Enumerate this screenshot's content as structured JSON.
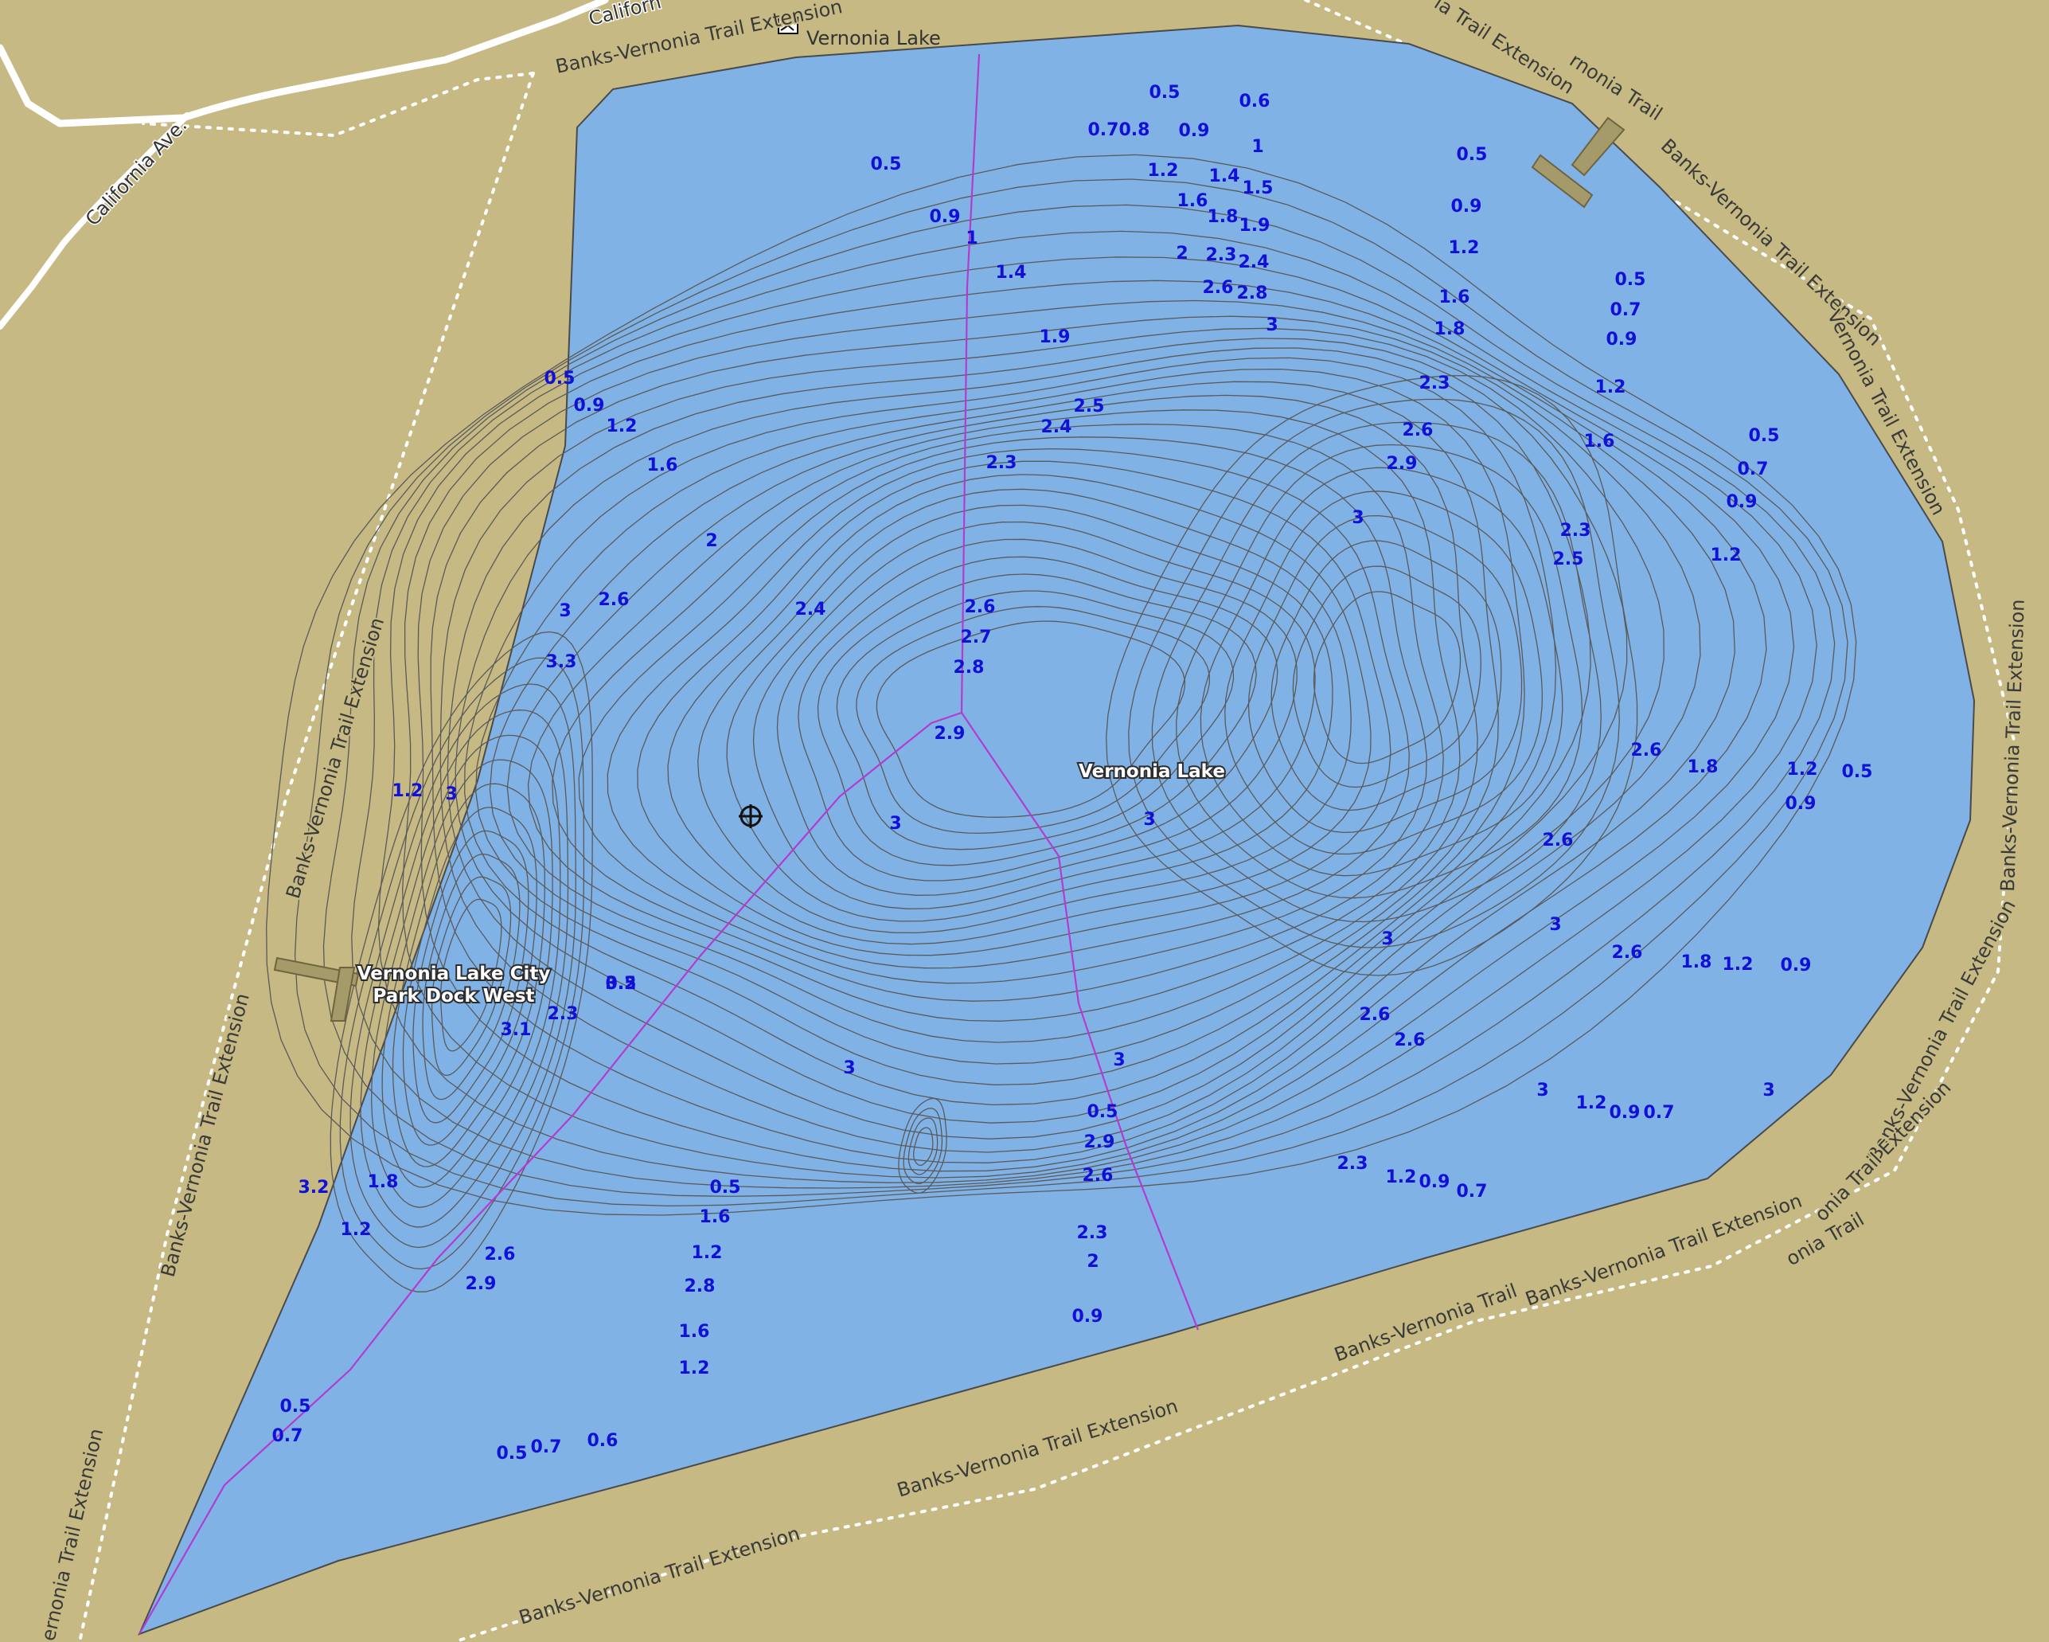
{
  "map": {
    "colors": {
      "land": "#c6b983",
      "water": "#80b2e6",
      "contour": "#5a5a5a",
      "depth_label": "#1010d8",
      "survey_line": "#b23cd0",
      "road": "#ffffff",
      "dock": "#a59a6a"
    },
    "icons": [
      "marina-icon",
      "crosshair-icon"
    ],
    "lake_name": "Vernonia Lake",
    "lake_name_top": "Vernonia Lake",
    "dock_name_line1": "Vernonia Lake City",
    "dock_name_line2": "Park Dock West",
    "road_name_diag": "California Ave.",
    "road_name_top": "Californ",
    "trails": {
      "t_top": "Banks-Vernonia Trail Extension",
      "t_topright": "ia Trail Extension",
      "t_topright2": "rnonia Trail",
      "t_right_diag1": "Banks-Vernonia Trail Extension",
      "t_right_diag2": "Vernonia Trail Extension",
      "t_right_vert": "Banks-Vernonia Trail Extension",
      "t_right_lower": "Banks-Vernonia Trail Extension",
      "t_right_lower2": "onia Trail Extension",
      "t_right_bottom": "onia Trail",
      "t_bottom_right1": "Banks-Vernonia Trail",
      "t_bottom_right2": "Banks-Vernonia Trail Extension",
      "t_bottom_mid": "Banks-Vernonia Trail Extension",
      "t_bottom_left": "Banks-Vernonia Trail Extension",
      "t_left_upper": "Banks-Vernonia Trail Extension",
      "t_left_lower": "Banks-Vernonia Trail Extension",
      "t_left_bottom": "ernonia Trail Extension"
    },
    "depth_labels": [
      "0.5",
      "0.6",
      "0.7",
      "0.8",
      "0.9",
      "1",
      "0.5",
      "0.9",
      "1",
      "1.2",
      "1.4",
      "1.5",
      "1.6",
      "1.8",
      "1.9",
      "1.4",
      "2",
      "2.3",
      "2.4",
      "2.6",
      "2.8",
      "1.9",
      "3",
      "0.5",
      "0.9",
      "1.2",
      "1.6",
      "1.8",
      "0.5",
      "0.7",
      "0.9",
      "1.2",
      "2.3",
      "2.5",
      "2.4",
      "2.3",
      "2.6",
      "2.9",
      "1.6",
      "0.5",
      "0.7",
      "0.9",
      "0.5",
      "0.9",
      "1.2",
      "1.6",
      "2",
      "3",
      "2.3",
      "2.5",
      "1.2",
      "3",
      "2.6",
      "2.4",
      "2.6",
      "2.7",
      "2.8",
      "3",
      "3.3",
      "2.9",
      "3",
      "2.6",
      "1.8",
      "1.2",
      "0.9",
      "0.5",
      "1.2",
      "3",
      "3",
      "2.6",
      "3",
      "3",
      "2.6",
      "1.8",
      "1.2",
      "0.9",
      "0.5",
      "3",
      "2.6",
      "2.3",
      "3.1",
      "3.2",
      "3",
      "3",
      "1.2",
      "0.9",
      "0.7",
      "0.5",
      "2.9",
      "2.6",
      "2.6",
      "2.3",
      "1.2",
      "0.9",
      "0.7",
      "0.5",
      "2.3",
      "1.6",
      "2",
      "1.2",
      "1.8",
      "3.2",
      "1.2",
      "2.6",
      "2.9",
      "2.8",
      "1.6",
      "1.2",
      "0.9",
      "0.5",
      "0.7",
      "0.5",
      "0.7",
      "0.6",
      "0.5"
    ]
  }
}
